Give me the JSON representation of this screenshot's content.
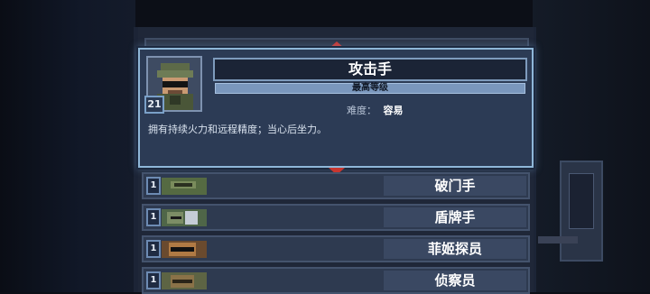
{
  "header_partial": "攻击手",
  "selected": {
    "name": "攻击手",
    "subtitle": "最高等级",
    "level": "21",
    "difficulty_label": "难度：",
    "difficulty_value": "容易",
    "description": "拥有持续火力和远程精度；当心后坐力。"
  },
  "classes": [
    {
      "level": "1",
      "name": "破门手",
      "thumb_color": "#556a42"
    },
    {
      "level": "1",
      "name": "盾牌手",
      "thumb_color": "#4f6648"
    },
    {
      "level": "1",
      "name": "菲姬探员",
      "thumb_color": "#b07a44"
    },
    {
      "level": "1",
      "name": "侦察员",
      "thumb_color": "#8a7248"
    }
  ]
}
